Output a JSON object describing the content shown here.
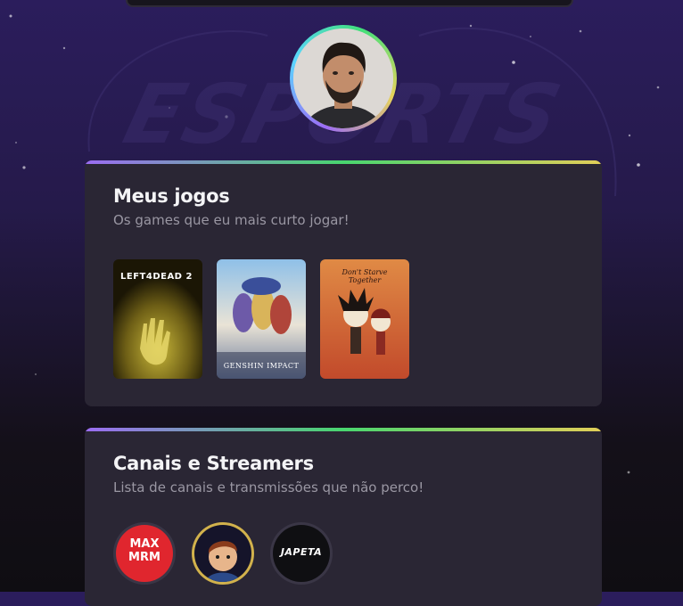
{
  "profile": {
    "avatar_alt": "Foto de perfil"
  },
  "background": {
    "logo_text": "ESPORTS"
  },
  "games_section": {
    "title": "Meus jogos",
    "subtitle": "Os games que eu mais curto jogar!",
    "games": [
      {
        "name": "Left 4 Dead 2",
        "cover_text": "LEFT4DEAD 2"
      },
      {
        "name": "Genshin Impact",
        "cover_text": "GENSHIN IMPACT"
      },
      {
        "name": "Don't Starve Together",
        "cover_text": "Don't Starve Together"
      }
    ]
  },
  "channels_section": {
    "title": "Canais e Streamers",
    "subtitle": "Lista de canais e transmissões que não perco!",
    "channels": [
      {
        "name": "Max MRM Gameplay",
        "logo_text": "MAX MRM"
      },
      {
        "name": "Streamer avatar",
        "logo_text": ""
      },
      {
        "name": "Japeta Gameplay",
        "logo_text": "JAPETA"
      }
    ]
  },
  "colors": {
    "card_bg": "#2a2634",
    "gradient": [
      "#9b6cf2",
      "#49d66f",
      "#e2cf58"
    ],
    "title": "#f4f4f6",
    "subtitle": "#9a97a3"
  }
}
